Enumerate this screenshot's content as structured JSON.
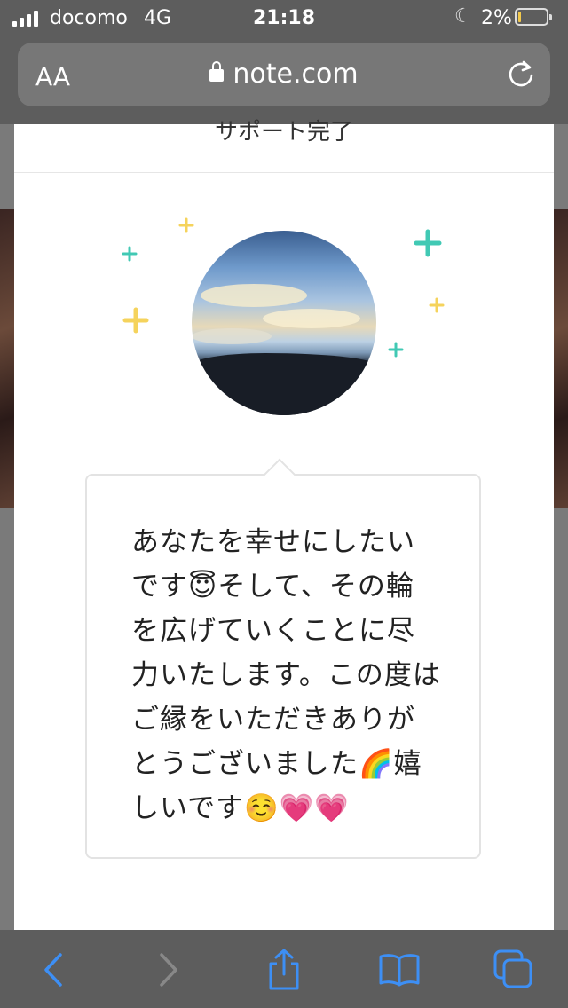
{
  "status": {
    "carrier": "docomo",
    "network": "4G",
    "time": "21:18",
    "battery": "2%"
  },
  "browser": {
    "text_size_label": "AA",
    "domain": "note.com"
  },
  "page": {
    "partial_title": "サポート完了",
    "message": "あなたを幸せにしたいです😇そして、その輪を広げていくことに尽力いたします。この度はご縁をいただきありがとうございました🌈嬉しいです☺️💗💗"
  },
  "colors": {
    "accent_teal": "#41c9b4",
    "accent_yellow": "#f5d35c",
    "toolbar_icon": "#3d8ff5"
  },
  "icons": [
    "lock-icon",
    "reload-icon",
    "back-icon",
    "forward-icon",
    "share-icon",
    "bookmarks-icon",
    "tabs-icon",
    "moon-icon"
  ]
}
